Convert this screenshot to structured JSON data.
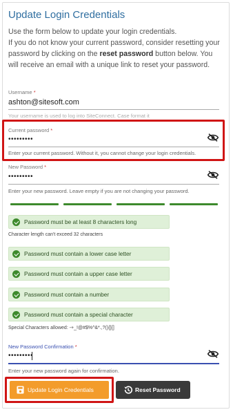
{
  "title": "Update Login Credentials",
  "intro": {
    "line1": "Use the form below to update your login credentials.",
    "line2_pre": "If you do not know your current password, consider resetting your password by clicking on the ",
    "line2_bold": "reset password",
    "line2_post": " button below. You will receive an email with a unique link to reset your password."
  },
  "username": {
    "label": "Username",
    "value": "ashton@sitesoft.com",
    "hint": "Your username is used to log into SiteConnect. Case format it"
  },
  "current_password": {
    "label": "Current password",
    "value": "•••••••••",
    "hint": "Enter your current password. Without it, you cannot change your login credentials."
  },
  "new_password": {
    "label": "New Password",
    "value": "•••••••••",
    "hint": "Enter your new password. Leave empty if you are not changing your password."
  },
  "strength_segments": 4,
  "rules": [
    "Password must be at least 8 characters long",
    "Password must contain a lower case letter",
    "Password must contain a upper case letter",
    "Password must contain a number",
    "Password must contain a special character"
  ],
  "notes": {
    "char_limit": "Character length can't exceed 32 characters",
    "special_chars": "Special Characters allowed: -+_!@#$%^&*.,?(){}[]"
  },
  "confirm_password": {
    "label": "New Password Confirmation",
    "value": "•••••••••",
    "hint": "Enter your new password again for confirmation."
  },
  "buttons": {
    "update": "Update Login Credentials",
    "reset": "Reset Password"
  },
  "icons": {
    "eye_off": "eye-off-icon",
    "save": "save-icon",
    "reset": "history-icon"
  },
  "colors": {
    "title": "#2f6ea0",
    "highlight": "#d01515",
    "success": "#3d8a2c",
    "update_button": "#f39c2b",
    "reset_button": "#3a3a3a"
  }
}
